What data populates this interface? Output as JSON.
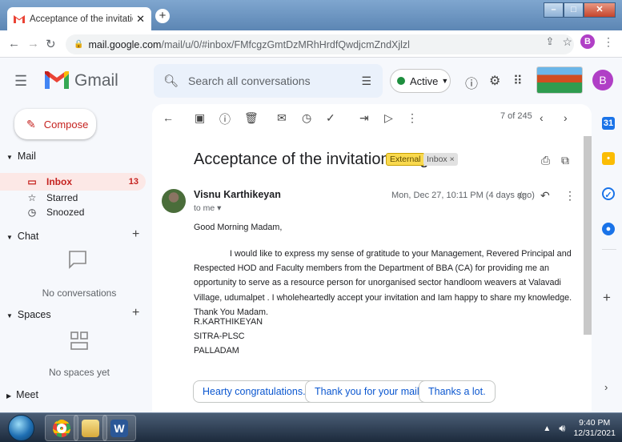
{
  "browser": {
    "tab_title": "Acceptance of the invitation -Re",
    "tab_close": "✕",
    "new_tab": "+",
    "url_host": "mail.google.com",
    "url_path": "/mail/u/0/#inbox/FMfcgzGmtDzMRhHrdfQwdjcmZndXjlzl",
    "profile_initial": "B"
  },
  "gmail": {
    "logo_text": "Gmail",
    "search_placeholder": "Search all conversations",
    "status_label": "Active",
    "account_initial": "B"
  },
  "sidebar": {
    "compose_label": "Compose",
    "mail_section": "Mail",
    "items": [
      {
        "label": "Inbox",
        "count": "13"
      },
      {
        "label": "Starred"
      },
      {
        "label": "Snoozed"
      }
    ],
    "chat_section": "Chat",
    "chat_empty": "No conversations",
    "spaces_section": "Spaces",
    "spaces_empty": "No spaces yet",
    "meet_section": "Meet"
  },
  "toolbar": {
    "pager": "7 of 245"
  },
  "email": {
    "subject": "Acceptance of the invitation -Reg",
    "label_external": "External",
    "label_inbox": "Inbox ×",
    "sender": "Visnu Karthikeyan",
    "to": "to me ▾",
    "date": "Mon, Dec 27, 10:11 PM (4 days ago)",
    "greeting": "Good Morning Madam,",
    "body": "I would like to express my sense of gratitude to your Management, Revered Principal and Respected HOD and Faculty members from the Department of BBA (CA) for providing me an opportunity to serve as a resource person for unorganised sector handloom weavers at Valavadi Village, udumalpet . I wholeheartedly accept your invitation and Iam happy to share my knowledge. Thank You Madam.",
    "signature": [
      "R.KARTHIKEYAN",
      "SITRA-PLSC",
      "PALLADAM"
    ]
  },
  "smart_replies": [
    "Hearty congratulations.",
    "Thank you for your mail.",
    "Thanks a lot."
  ],
  "taskbar": {
    "time": "9:40 PM",
    "date": "12/31/2021"
  },
  "colors": {
    "accent_red": "#c5221f",
    "external_label": "#f9d94e",
    "active_green": "#1e8e3e"
  }
}
